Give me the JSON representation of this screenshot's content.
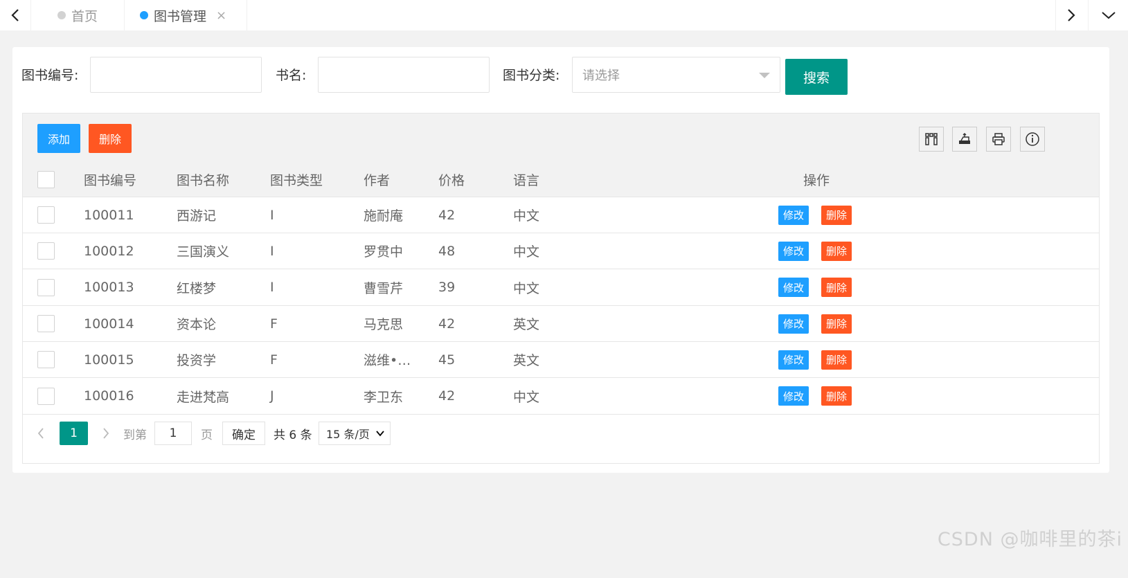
{
  "tabs": {
    "home_label": "首页",
    "book_label": "图书管理",
    "close_glyph": "×"
  },
  "search": {
    "id_label": "图书编号:",
    "id_value": "",
    "name_label": "书名:",
    "name_value": "",
    "category_label": "图书分类:",
    "category_placeholder": "请选择",
    "search_button": "搜索"
  },
  "toolbar": {
    "add_label": "添加",
    "delete_label": "删除",
    "icons": [
      "columns-icon",
      "export-icon",
      "print-icon",
      "info-icon"
    ]
  },
  "table": {
    "columns": [
      "图书编号",
      "图书名称",
      "图书类型",
      "作者",
      "价格",
      "语言",
      "操作"
    ],
    "rows": [
      {
        "id": "100011",
        "name": "西游记",
        "type": "I",
        "author": "施耐庵",
        "price": "42",
        "lang": "中文"
      },
      {
        "id": "100012",
        "name": "三国演义",
        "type": "I",
        "author": "罗贯中",
        "price": "48",
        "lang": "中文"
      },
      {
        "id": "100013",
        "name": "红楼梦",
        "type": "I",
        "author": "曹雪芹",
        "price": "39",
        "lang": "中文"
      },
      {
        "id": "100014",
        "name": "资本论",
        "type": "F",
        "author": "马克思",
        "price": "42",
        "lang": "英文"
      },
      {
        "id": "100015",
        "name": "投资学",
        "type": "F",
        "author": "滋维•…",
        "price": "45",
        "lang": "英文"
      },
      {
        "id": "100016",
        "name": "走进梵高",
        "type": "J",
        "author": "李卫东",
        "price": "42",
        "lang": "中文"
      }
    ],
    "edit_label": "修改",
    "row_delete_label": "删除"
  },
  "pager": {
    "prev": "<",
    "current_page": "1",
    "next": ">",
    "goto_label": "到第",
    "goto_value": "1",
    "page_unit": "页",
    "confirm": "确定",
    "total": "共 6 条",
    "page_size": "15 条/页"
  },
  "watermark": "CSDN @咖啡里的茶i",
  "colors": {
    "primary_green": "#009688",
    "blue": "#1e9fff",
    "orange": "#ff5722"
  }
}
